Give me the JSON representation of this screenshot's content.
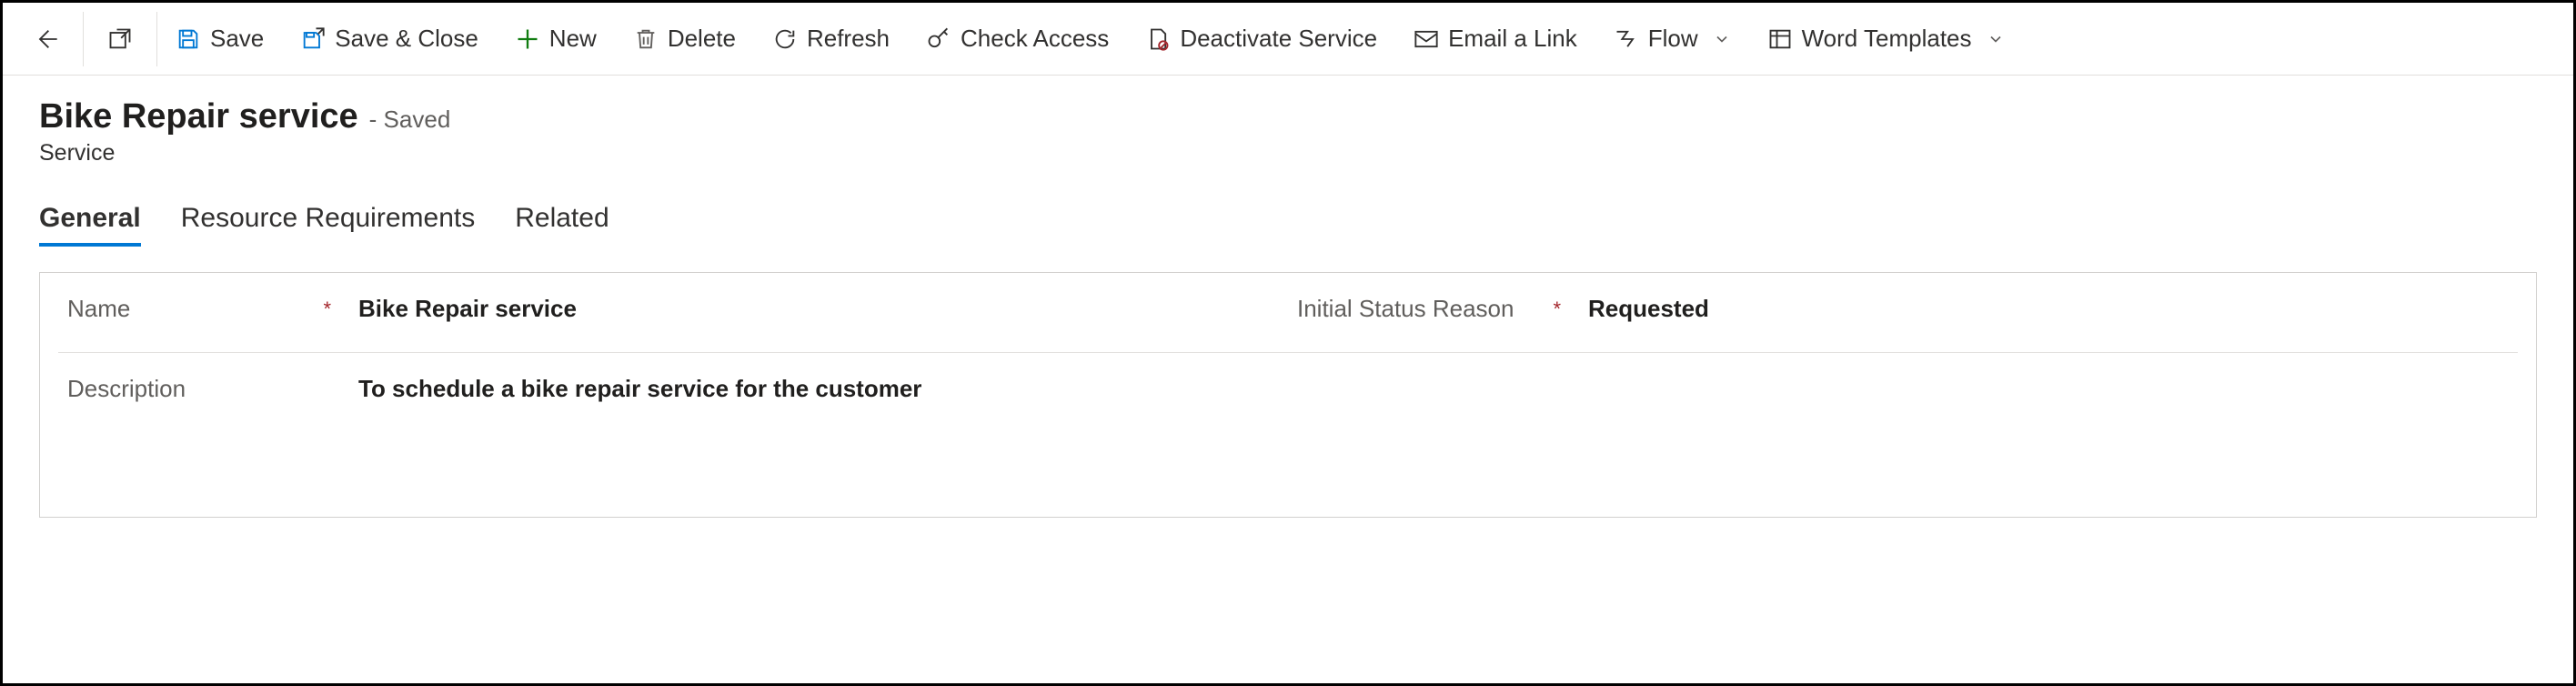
{
  "commandbar": {
    "save": "Save",
    "saveClose": "Save & Close",
    "new": "New",
    "delete": "Delete",
    "refresh": "Refresh",
    "checkAccess": "Check Access",
    "deactivate": "Deactivate Service",
    "emailLink": "Email a Link",
    "flow": "Flow",
    "wordTemplates": "Word Templates"
  },
  "header": {
    "title": "Bike Repair service",
    "savedLabel": "- Saved",
    "entity": "Service"
  },
  "tabs": {
    "general": "General",
    "resourceReq": "Resource Requirements",
    "related": "Related"
  },
  "form": {
    "nameLabel": "Name",
    "nameValue": "Bike Repair service",
    "statusLabel": "Initial Status Reason",
    "statusValue": "Requested",
    "descLabel": "Description",
    "descValue": "To schedule a bike repair service for the customer",
    "requiredMark": "*"
  }
}
